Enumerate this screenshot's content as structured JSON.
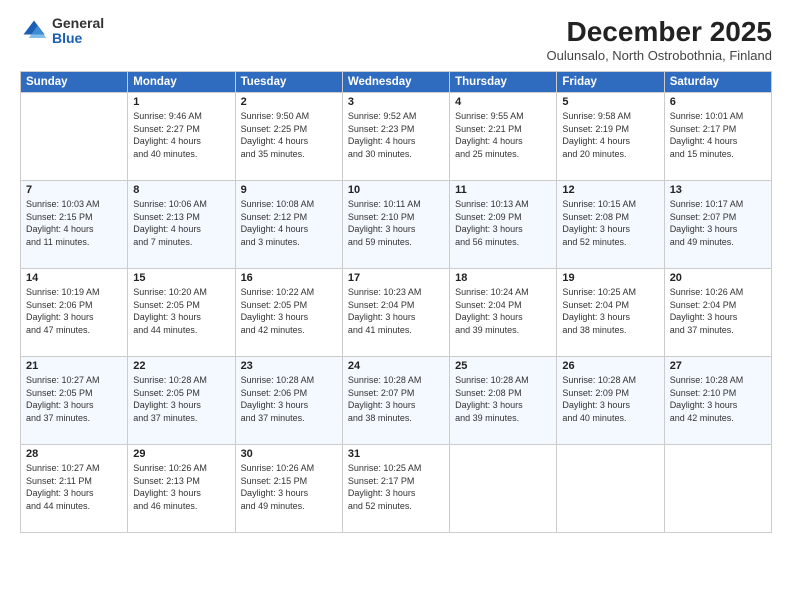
{
  "logo": {
    "general": "General",
    "blue": "Blue"
  },
  "header": {
    "title": "December 2025",
    "subtitle": "Oulunsalo, North Ostrobothnia, Finland"
  },
  "weekdays": [
    "Sunday",
    "Monday",
    "Tuesday",
    "Wednesday",
    "Thursday",
    "Friday",
    "Saturday"
  ],
  "weeks": [
    [
      {
        "day": "",
        "lines": []
      },
      {
        "day": "1",
        "lines": [
          "Sunrise: 9:46 AM",
          "Sunset: 2:27 PM",
          "Daylight: 4 hours",
          "and 40 minutes."
        ]
      },
      {
        "day": "2",
        "lines": [
          "Sunrise: 9:50 AM",
          "Sunset: 2:25 PM",
          "Daylight: 4 hours",
          "and 35 minutes."
        ]
      },
      {
        "day": "3",
        "lines": [
          "Sunrise: 9:52 AM",
          "Sunset: 2:23 PM",
          "Daylight: 4 hours",
          "and 30 minutes."
        ]
      },
      {
        "day": "4",
        "lines": [
          "Sunrise: 9:55 AM",
          "Sunset: 2:21 PM",
          "Daylight: 4 hours",
          "and 25 minutes."
        ]
      },
      {
        "day": "5",
        "lines": [
          "Sunrise: 9:58 AM",
          "Sunset: 2:19 PM",
          "Daylight: 4 hours",
          "and 20 minutes."
        ]
      },
      {
        "day": "6",
        "lines": [
          "Sunrise: 10:01 AM",
          "Sunset: 2:17 PM",
          "Daylight: 4 hours",
          "and 15 minutes."
        ]
      }
    ],
    [
      {
        "day": "7",
        "lines": [
          "Sunrise: 10:03 AM",
          "Sunset: 2:15 PM",
          "Daylight: 4 hours",
          "and 11 minutes."
        ]
      },
      {
        "day": "8",
        "lines": [
          "Sunrise: 10:06 AM",
          "Sunset: 2:13 PM",
          "Daylight: 4 hours",
          "and 7 minutes."
        ]
      },
      {
        "day": "9",
        "lines": [
          "Sunrise: 10:08 AM",
          "Sunset: 2:12 PM",
          "Daylight: 4 hours",
          "and 3 minutes."
        ]
      },
      {
        "day": "10",
        "lines": [
          "Sunrise: 10:11 AM",
          "Sunset: 2:10 PM",
          "Daylight: 3 hours",
          "and 59 minutes."
        ]
      },
      {
        "day": "11",
        "lines": [
          "Sunrise: 10:13 AM",
          "Sunset: 2:09 PM",
          "Daylight: 3 hours",
          "and 56 minutes."
        ]
      },
      {
        "day": "12",
        "lines": [
          "Sunrise: 10:15 AM",
          "Sunset: 2:08 PM",
          "Daylight: 3 hours",
          "and 52 minutes."
        ]
      },
      {
        "day": "13",
        "lines": [
          "Sunrise: 10:17 AM",
          "Sunset: 2:07 PM",
          "Daylight: 3 hours",
          "and 49 minutes."
        ]
      }
    ],
    [
      {
        "day": "14",
        "lines": [
          "Sunrise: 10:19 AM",
          "Sunset: 2:06 PM",
          "Daylight: 3 hours",
          "and 47 minutes."
        ]
      },
      {
        "day": "15",
        "lines": [
          "Sunrise: 10:20 AM",
          "Sunset: 2:05 PM",
          "Daylight: 3 hours",
          "and 44 minutes."
        ]
      },
      {
        "day": "16",
        "lines": [
          "Sunrise: 10:22 AM",
          "Sunset: 2:05 PM",
          "Daylight: 3 hours",
          "and 42 minutes."
        ]
      },
      {
        "day": "17",
        "lines": [
          "Sunrise: 10:23 AM",
          "Sunset: 2:04 PM",
          "Daylight: 3 hours",
          "and 41 minutes."
        ]
      },
      {
        "day": "18",
        "lines": [
          "Sunrise: 10:24 AM",
          "Sunset: 2:04 PM",
          "Daylight: 3 hours",
          "and 39 minutes."
        ]
      },
      {
        "day": "19",
        "lines": [
          "Sunrise: 10:25 AM",
          "Sunset: 2:04 PM",
          "Daylight: 3 hours",
          "and 38 minutes."
        ]
      },
      {
        "day": "20",
        "lines": [
          "Sunrise: 10:26 AM",
          "Sunset: 2:04 PM",
          "Daylight: 3 hours",
          "and 37 minutes."
        ]
      }
    ],
    [
      {
        "day": "21",
        "lines": [
          "Sunrise: 10:27 AM",
          "Sunset: 2:05 PM",
          "Daylight: 3 hours",
          "and 37 minutes."
        ]
      },
      {
        "day": "22",
        "lines": [
          "Sunrise: 10:28 AM",
          "Sunset: 2:05 PM",
          "Daylight: 3 hours",
          "and 37 minutes."
        ]
      },
      {
        "day": "23",
        "lines": [
          "Sunrise: 10:28 AM",
          "Sunset: 2:06 PM",
          "Daylight: 3 hours",
          "and 37 minutes."
        ]
      },
      {
        "day": "24",
        "lines": [
          "Sunrise: 10:28 AM",
          "Sunset: 2:07 PM",
          "Daylight: 3 hours",
          "and 38 minutes."
        ]
      },
      {
        "day": "25",
        "lines": [
          "Sunrise: 10:28 AM",
          "Sunset: 2:08 PM",
          "Daylight: 3 hours",
          "and 39 minutes."
        ]
      },
      {
        "day": "26",
        "lines": [
          "Sunrise: 10:28 AM",
          "Sunset: 2:09 PM",
          "Daylight: 3 hours",
          "and 40 minutes."
        ]
      },
      {
        "day": "27",
        "lines": [
          "Sunrise: 10:28 AM",
          "Sunset: 2:10 PM",
          "Daylight: 3 hours",
          "and 42 minutes."
        ]
      }
    ],
    [
      {
        "day": "28",
        "lines": [
          "Sunrise: 10:27 AM",
          "Sunset: 2:11 PM",
          "Daylight: 3 hours",
          "and 44 minutes."
        ]
      },
      {
        "day": "29",
        "lines": [
          "Sunrise: 10:26 AM",
          "Sunset: 2:13 PM",
          "Daylight: 3 hours",
          "and 46 minutes."
        ]
      },
      {
        "day": "30",
        "lines": [
          "Sunrise: 10:26 AM",
          "Sunset: 2:15 PM",
          "Daylight: 3 hours",
          "and 49 minutes."
        ]
      },
      {
        "day": "31",
        "lines": [
          "Sunrise: 10:25 AM",
          "Sunset: 2:17 PM",
          "Daylight: 3 hours",
          "and 52 minutes."
        ]
      },
      {
        "day": "",
        "lines": []
      },
      {
        "day": "",
        "lines": []
      },
      {
        "day": "",
        "lines": []
      }
    ]
  ]
}
